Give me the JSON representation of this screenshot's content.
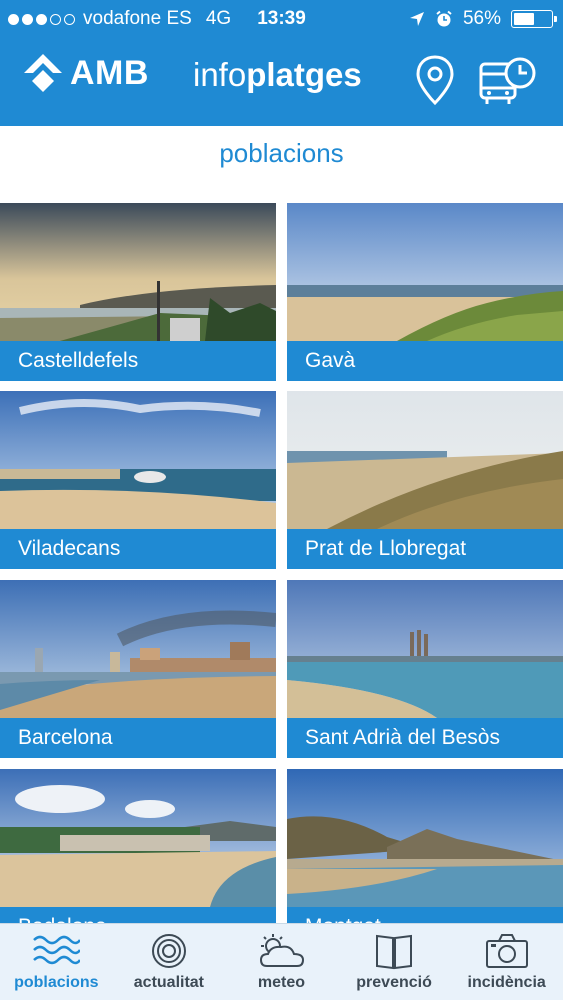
{
  "status_bar": {
    "carrier": "vodafone ES",
    "network": "4G",
    "time": "13:39",
    "battery_percent_text": "56%",
    "battery_level": 0.56,
    "signal_bars_filled": 3,
    "signal_bars_total": 5
  },
  "header": {
    "brand": "AMB",
    "title_light": "info",
    "title_bold": "platges",
    "icons": [
      "location-pin-icon",
      "bus-schedule-icon"
    ]
  },
  "section_title": "poblacions",
  "towns": [
    {
      "name": "Castelldefels"
    },
    {
      "name": "Gavà"
    },
    {
      "name": "Viladecans"
    },
    {
      "name": "Prat de Llobregat"
    },
    {
      "name": "Barcelona"
    },
    {
      "name": "Sant Adrià del Besòs"
    },
    {
      "name": "Badalona"
    },
    {
      "name": "Montgat"
    }
  ],
  "tabs": [
    {
      "label": "poblacions",
      "icon": "waves-icon",
      "active": true
    },
    {
      "label": "actualitat",
      "icon": "target-icon",
      "active": false
    },
    {
      "label": "meteo",
      "icon": "sun-cloud-icon",
      "active": false
    },
    {
      "label": "prevenció",
      "icon": "book-icon",
      "active": false
    },
    {
      "label": "incidència",
      "icon": "camera-icon",
      "active": false
    }
  ],
  "colors": {
    "accent": "#1f8ad3",
    "tabbar_bg": "#e9f2fa",
    "inactive_tab_text": "#3d4a55"
  }
}
